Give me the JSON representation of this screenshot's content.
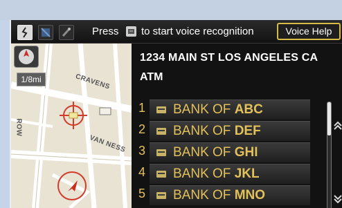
{
  "topbar": {
    "press_text": "Press",
    "press_text2": "to start voice recognition",
    "voice_help_label": "Voice Help",
    "mode_icons": [
      "route-icon",
      "satellite-icon",
      "traffic-icon"
    ],
    "talk_icon": "talk-button-icon"
  },
  "map": {
    "scale_label": "1/8mi",
    "street_labels": [
      "CRAVENS",
      "VAN NESS",
      "ROW"
    ],
    "colors": {
      "background": "#e9e3d3",
      "target": "#d23a2a"
    }
  },
  "panel": {
    "address": "1234 MAIN ST LOS ANGELES CA",
    "category": "ATM",
    "results": [
      {
        "num": "1",
        "prefix": "BANK OF ",
        "suffix": "ABC"
      },
      {
        "num": "2",
        "prefix": "BANK OF ",
        "suffix": "DEF"
      },
      {
        "num": "3",
        "prefix": "BANK OF ",
        "suffix": "GHI"
      },
      {
        "num": "4",
        "prefix": "BANK OF ",
        "suffix": "JKL"
      },
      {
        "num": "5",
        "prefix": "BANK OF ",
        "suffix": "MNO"
      }
    ],
    "scroll_up_icon": "chevron-up-icon",
    "scroll_down_icon": "chevron-down-icon"
  },
  "colors": {
    "accent_gold": "#e3c15a",
    "voice_help_border": "#d8bb47",
    "screen_bg": "#141414"
  }
}
